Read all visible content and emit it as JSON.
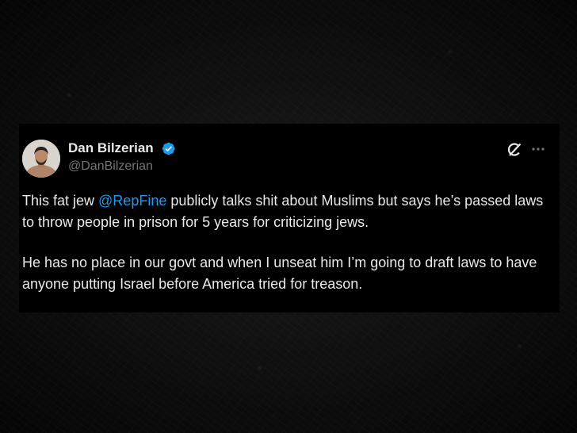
{
  "tweet": {
    "author_name": "Dan Bilzerian",
    "handle": "@DanBilzerian",
    "verified": true,
    "paragraph1": {
      "before": "This fat jew ",
      "mention": "@RepFine",
      "after": " publicly talks shit about Muslims but says he’s passed laws to throw people in prison for 5 years for criticizing jews."
    },
    "paragraph2": "He has no place in our govt and when I unseat him I’m going to draft laws to have anyone putting Israel before America tried for treason."
  },
  "icons": {
    "verified": "verified-badge-icon",
    "grok": "grok-icon",
    "more": "more-options-icon"
  },
  "colors": {
    "background": "#000000",
    "text": "#e7e9ea",
    "secondary": "#71767b",
    "accent": "#1d9bf0"
  }
}
